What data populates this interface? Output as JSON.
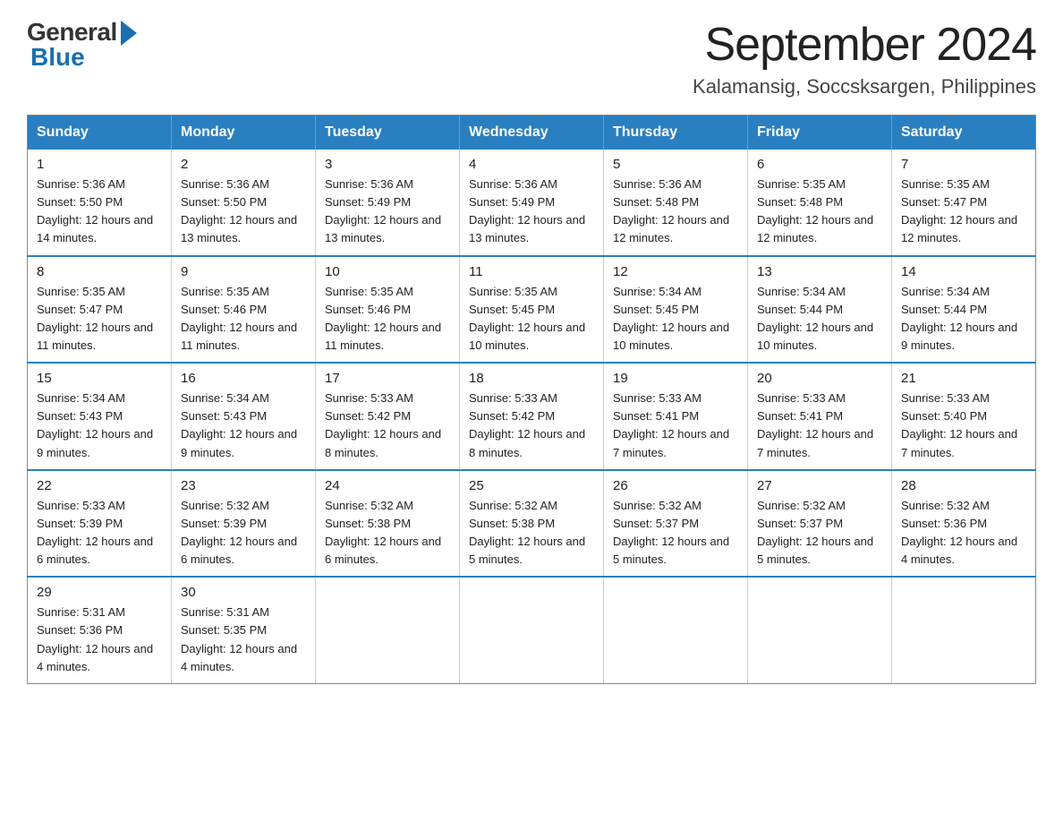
{
  "logo": {
    "general": "General",
    "blue": "Blue"
  },
  "header": {
    "month_year": "September 2024",
    "location": "Kalamansig, Soccsksargen, Philippines"
  },
  "weekdays": [
    "Sunday",
    "Monday",
    "Tuesday",
    "Wednesday",
    "Thursday",
    "Friday",
    "Saturday"
  ],
  "weeks": [
    [
      {
        "day": "1",
        "sunrise": "5:36 AM",
        "sunset": "5:50 PM",
        "daylight": "12 hours and 14 minutes."
      },
      {
        "day": "2",
        "sunrise": "5:36 AM",
        "sunset": "5:50 PM",
        "daylight": "12 hours and 13 minutes."
      },
      {
        "day": "3",
        "sunrise": "5:36 AM",
        "sunset": "5:49 PM",
        "daylight": "12 hours and 13 minutes."
      },
      {
        "day": "4",
        "sunrise": "5:36 AM",
        "sunset": "5:49 PM",
        "daylight": "12 hours and 13 minutes."
      },
      {
        "day": "5",
        "sunrise": "5:36 AM",
        "sunset": "5:48 PM",
        "daylight": "12 hours and 12 minutes."
      },
      {
        "day": "6",
        "sunrise": "5:35 AM",
        "sunset": "5:48 PM",
        "daylight": "12 hours and 12 minutes."
      },
      {
        "day": "7",
        "sunrise": "5:35 AM",
        "sunset": "5:47 PM",
        "daylight": "12 hours and 12 minutes."
      }
    ],
    [
      {
        "day": "8",
        "sunrise": "5:35 AM",
        "sunset": "5:47 PM",
        "daylight": "12 hours and 11 minutes."
      },
      {
        "day": "9",
        "sunrise": "5:35 AM",
        "sunset": "5:46 PM",
        "daylight": "12 hours and 11 minutes."
      },
      {
        "day": "10",
        "sunrise": "5:35 AM",
        "sunset": "5:46 PM",
        "daylight": "12 hours and 11 minutes."
      },
      {
        "day": "11",
        "sunrise": "5:35 AM",
        "sunset": "5:45 PM",
        "daylight": "12 hours and 10 minutes."
      },
      {
        "day": "12",
        "sunrise": "5:34 AM",
        "sunset": "5:45 PM",
        "daylight": "12 hours and 10 minutes."
      },
      {
        "day": "13",
        "sunrise": "5:34 AM",
        "sunset": "5:44 PM",
        "daylight": "12 hours and 10 minutes."
      },
      {
        "day": "14",
        "sunrise": "5:34 AM",
        "sunset": "5:44 PM",
        "daylight": "12 hours and 9 minutes."
      }
    ],
    [
      {
        "day": "15",
        "sunrise": "5:34 AM",
        "sunset": "5:43 PM",
        "daylight": "12 hours and 9 minutes."
      },
      {
        "day": "16",
        "sunrise": "5:34 AM",
        "sunset": "5:43 PM",
        "daylight": "12 hours and 9 minutes."
      },
      {
        "day": "17",
        "sunrise": "5:33 AM",
        "sunset": "5:42 PM",
        "daylight": "12 hours and 8 minutes."
      },
      {
        "day": "18",
        "sunrise": "5:33 AM",
        "sunset": "5:42 PM",
        "daylight": "12 hours and 8 minutes."
      },
      {
        "day": "19",
        "sunrise": "5:33 AM",
        "sunset": "5:41 PM",
        "daylight": "12 hours and 7 minutes."
      },
      {
        "day": "20",
        "sunrise": "5:33 AM",
        "sunset": "5:41 PM",
        "daylight": "12 hours and 7 minutes."
      },
      {
        "day": "21",
        "sunrise": "5:33 AM",
        "sunset": "5:40 PM",
        "daylight": "12 hours and 7 minutes."
      }
    ],
    [
      {
        "day": "22",
        "sunrise": "5:33 AM",
        "sunset": "5:39 PM",
        "daylight": "12 hours and 6 minutes."
      },
      {
        "day": "23",
        "sunrise": "5:32 AM",
        "sunset": "5:39 PM",
        "daylight": "12 hours and 6 minutes."
      },
      {
        "day": "24",
        "sunrise": "5:32 AM",
        "sunset": "5:38 PM",
        "daylight": "12 hours and 6 minutes."
      },
      {
        "day": "25",
        "sunrise": "5:32 AM",
        "sunset": "5:38 PM",
        "daylight": "12 hours and 5 minutes."
      },
      {
        "day": "26",
        "sunrise": "5:32 AM",
        "sunset": "5:37 PM",
        "daylight": "12 hours and 5 minutes."
      },
      {
        "day": "27",
        "sunrise": "5:32 AM",
        "sunset": "5:37 PM",
        "daylight": "12 hours and 5 minutes."
      },
      {
        "day": "28",
        "sunrise": "5:32 AM",
        "sunset": "5:36 PM",
        "daylight": "12 hours and 4 minutes."
      }
    ],
    [
      {
        "day": "29",
        "sunrise": "5:31 AM",
        "sunset": "5:36 PM",
        "daylight": "12 hours and 4 minutes."
      },
      {
        "day": "30",
        "sunrise": "5:31 AM",
        "sunset": "5:35 PM",
        "daylight": "12 hours and 4 minutes."
      },
      null,
      null,
      null,
      null,
      null
    ]
  ]
}
